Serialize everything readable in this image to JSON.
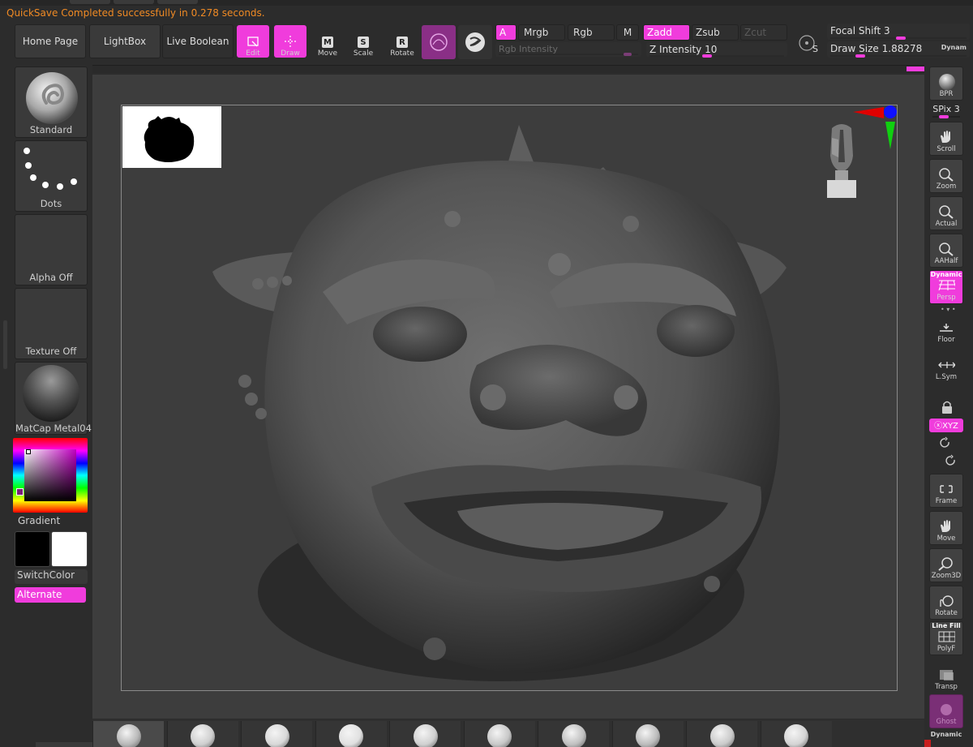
{
  "status_message": "QuickSave Completed successfully in 0.278 seconds.",
  "colors": {
    "accent": "#f03cdc",
    "status": "#f08a24",
    "bg": "#2c2c2c",
    "canvas": "#3d3d3d"
  },
  "toolbar": {
    "home_page": "Home Page",
    "lightbox": "LightBox",
    "live_boolean": "Live Boolean",
    "edit": "Edit",
    "draw": "Draw",
    "move": "Move",
    "scale": "Scale",
    "rotate": "Rotate",
    "move_glyph": "M",
    "scale_glyph": "S",
    "rotate_glyph": "R"
  },
  "color_modes": {
    "a": "A",
    "mrgb": "Mrgb",
    "rgb": "Rgb",
    "m": "M",
    "rgb_intensity": "Rgb Intensity",
    "rgb_intensity_value": 0.95
  },
  "depth_modes": {
    "zadd": "Zadd",
    "zsub": "Zsub",
    "zcut": "Zcut",
    "z_intensity_label": "Z Intensity",
    "z_intensity_value": "10",
    "z_intensity_fraction": 0.42
  },
  "brush_settings": {
    "lazy_label": "S",
    "focal_shift_label": "Focal Shift",
    "focal_shift_value": "3",
    "focal_shift_fraction": 0.52,
    "draw_size_label": "Draw Size",
    "draw_size_value": "1.88278",
    "draw_size_fraction": 0.2,
    "dynamic_label": "Dynam"
  },
  "left_panel": {
    "brush": "Standard",
    "stroke": "Dots",
    "alpha": "Alpha Off",
    "texture": "Texture Off",
    "material": "MatCap Metal04",
    "gradient": "Gradient",
    "switch_color": "SwitchColor",
    "alternate": "Alternate"
  },
  "right_panel": {
    "bpr": "BPR",
    "spix_label": "SPix",
    "spix_value": "3",
    "scroll": "Scroll",
    "zoom": "Zoom",
    "actual": "Actual",
    "aahalf": "AAHalf",
    "dynamic": "Dynamic",
    "persp": "Persp",
    "floor": "Floor",
    "lsym": "L.Sym",
    "xyz": "ⓧXYZ",
    "frame": "Frame",
    "move": "Move",
    "zoom3d": "Zoom3D",
    "rotate": "Rotate",
    "line_fill": "Line Fill",
    "polyf": "PolyF",
    "transp": "Transp",
    "ghost": "Ghost",
    "dynamic_bottom": "Dynamic"
  },
  "shelf_count": 10
}
